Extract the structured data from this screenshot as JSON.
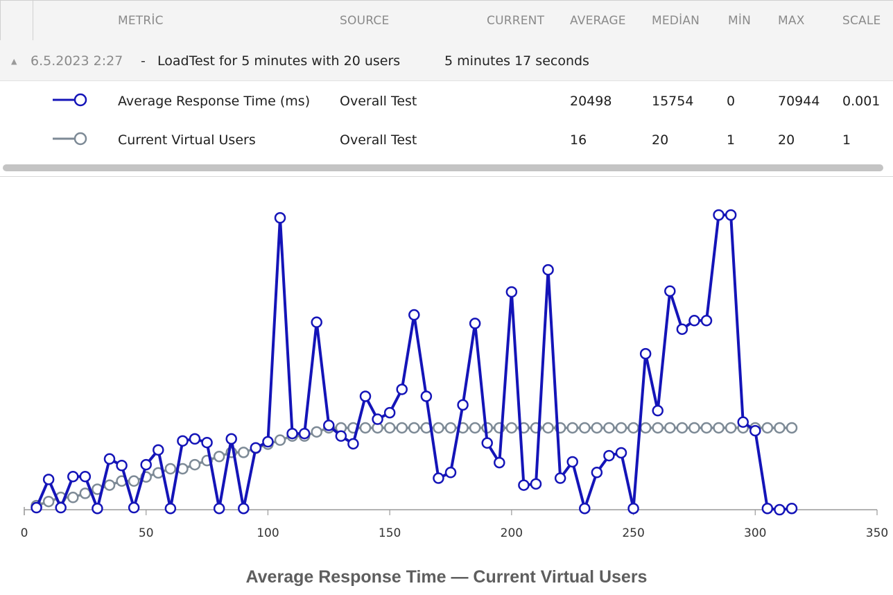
{
  "table": {
    "headers": [
      "METRİC",
      "SOURCE",
      "CURRENT",
      "AVERAGE",
      "MEDİAN",
      "MİN",
      "MAX",
      "SCALE"
    ],
    "group": {
      "date": "6.5.2023 2:27",
      "separator": "-",
      "name": "LoadTest for 5 minutes with 20 users",
      "duration": "5 minutes 17 seconds"
    },
    "rows": [
      {
        "metric": "Average Response Time (ms)",
        "source": "Overall Test",
        "current": "",
        "average": "20498",
        "median": "15754",
        "min": "0",
        "max": "70944",
        "scale": "0.001"
      },
      {
        "metric": "Current Virtual Users",
        "source": "Overall Test",
        "current": "",
        "average": "16",
        "median": "20",
        "min": "1",
        "max": "20",
        "scale": "1"
      }
    ]
  },
  "colors": {
    "response": "#1414b8",
    "users": "#7d8a96"
  },
  "chart_data": {
    "type": "line",
    "title": "Average Response Time — Current Virtual Users",
    "xlim": [
      0,
      350
    ],
    "ylim": [
      0,
      72
    ],
    "x_ticks": [
      0,
      50,
      100,
      150,
      200,
      250,
      300,
      350
    ],
    "y_unit_note": "scaled values (response time × 0.001, users × 1)",
    "series": [
      {
        "name": "Average Response Time (ms)",
        "x": [
          5,
          10,
          15,
          20,
          25,
          30,
          35,
          40,
          45,
          50,
          55,
          60,
          65,
          70,
          75,
          80,
          85,
          90,
          95,
          100,
          105,
          110,
          115,
          120,
          125,
          130,
          135,
          140,
          145,
          150,
          155,
          160,
          165,
          170,
          175,
          180,
          185,
          190,
          195,
          200,
          205,
          210,
          215,
          220,
          225,
          230,
          235,
          240,
          245,
          250,
          255,
          260,
          265,
          270,
          275,
          280,
          285,
          290,
          295,
          300,
          305,
          310,
          315
        ],
        "y": [
          0.5,
          7.4,
          0.5,
          8.1,
          8.1,
          0.3,
          12.4,
          10.8,
          0.5,
          11.0,
          14.6,
          0.3,
          16.8,
          17.3,
          16.4,
          0.3,
          17.3,
          0.3,
          15.1,
          16.6,
          71.3,
          18.6,
          18.6,
          45.8,
          20.6,
          18.0,
          16.1,
          27.7,
          22.1,
          23.7,
          29.4,
          47.6,
          27.7,
          7.7,
          9.1,
          25.6,
          45.5,
          16.3,
          11.5,
          53.2,
          6.0,
          6.3,
          58.6,
          7.7,
          11.7,
          0.3,
          9.1,
          13.2,
          13.9,
          0.3,
          38.1,
          24.2,
          53.4,
          44.1,
          46.2,
          46.2,
          72.0,
          72.0,
          21.4,
          19.3,
          0.3,
          0.0,
          0.3
        ]
      },
      {
        "name": "Current Virtual Users",
        "x": [
          5,
          10,
          15,
          20,
          25,
          30,
          35,
          40,
          45,
          50,
          55,
          60,
          65,
          70,
          75,
          80,
          85,
          90,
          95,
          100,
          105,
          110,
          115,
          120,
          125,
          130,
          135,
          140,
          145,
          150,
          155,
          160,
          165,
          170,
          175,
          180,
          185,
          190,
          195,
          200,
          205,
          210,
          215,
          220,
          225,
          230,
          235,
          240,
          245,
          250,
          255,
          260,
          265,
          270,
          275,
          280,
          285,
          290,
          295,
          300,
          305,
          310,
          315
        ],
        "y": [
          1,
          2,
          3,
          3,
          4,
          5,
          6,
          7,
          7,
          8,
          9,
          10,
          10,
          11,
          12,
          13,
          14,
          14,
          15,
          16,
          17,
          18,
          18,
          19,
          20,
          20,
          20,
          20,
          20,
          20,
          20,
          20,
          20,
          20,
          20,
          20,
          20,
          20,
          20,
          20,
          20,
          20,
          20,
          20,
          20,
          20,
          20,
          20,
          20,
          20,
          20,
          20,
          20,
          20,
          20,
          20,
          20,
          20,
          20,
          20,
          20,
          20,
          20
        ]
      }
    ]
  }
}
